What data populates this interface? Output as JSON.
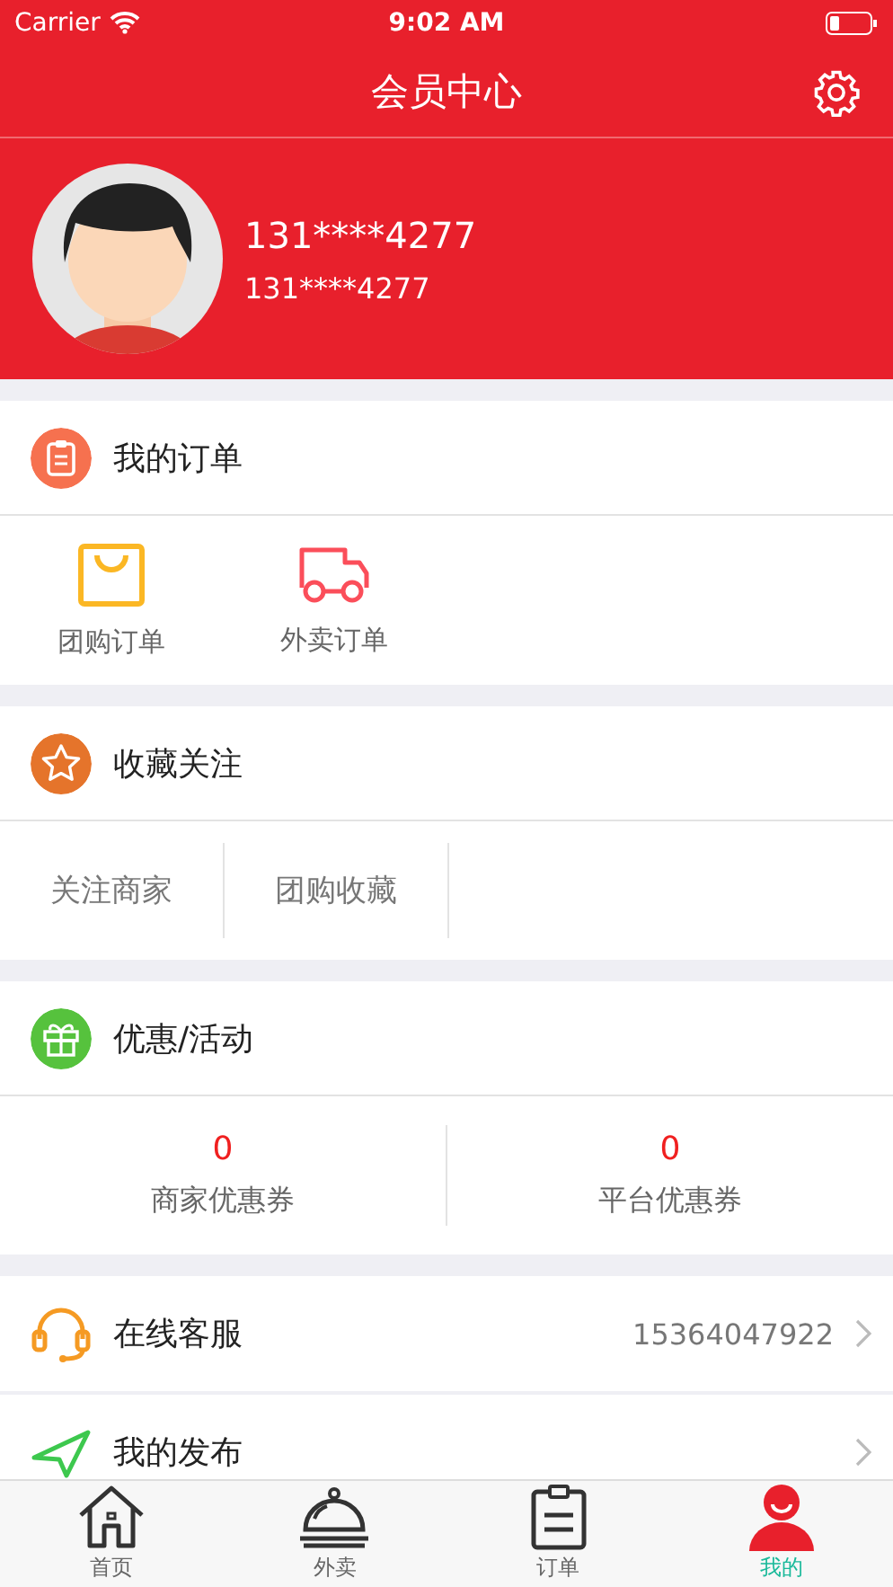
{
  "status_bar": {
    "carrier": "Carrier",
    "time": "9:02 AM"
  },
  "nav": {
    "title": "会员中心"
  },
  "profile": {
    "name": "131****4277",
    "phone": "131****4277"
  },
  "sections": [
    {
      "kind": "icons",
      "title": "我的订单",
      "items": [
        {
          "label": "团购订单"
        },
        {
          "label": "外卖订单"
        }
      ]
    },
    {
      "kind": "links",
      "title": "收藏关注",
      "items": [
        {
          "label": "关注商家"
        },
        {
          "label": "团购收藏"
        }
      ]
    },
    {
      "kind": "counts",
      "title": "优惠/活动",
      "items": [
        {
          "count": "0",
          "label": "商家优惠券"
        },
        {
          "count": "0",
          "label": "平台优惠券"
        }
      ]
    }
  ],
  "list_rows": [
    {
      "label": "在线客服",
      "value": "15364047922"
    },
    {
      "label": "我的发布"
    }
  ],
  "tab_bar": [
    {
      "label": "首页",
      "selected": false
    },
    {
      "label": "外卖",
      "selected": false
    },
    {
      "label": "订单",
      "selected": false
    },
    {
      "label": "我的",
      "selected": true
    }
  ]
}
